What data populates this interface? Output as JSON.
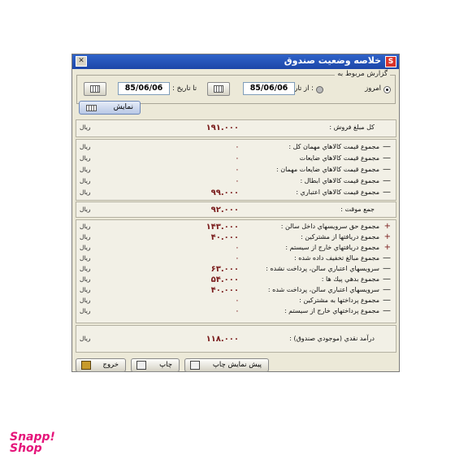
{
  "window": {
    "title": "خلاصه وضعيت صندوق",
    "app_icon": "app-logo-icon",
    "close_icon": "close-icon"
  },
  "report_group": {
    "label": "گزارش مربوط به",
    "today_label": "امروز",
    "from_label": ": از تاريخ",
    "to_label": "تا تاريخ :",
    "from_date": "85/06/06",
    "to_date": "85/06/06",
    "today_selected": true
  },
  "show_button": {
    "label": "نمايش"
  },
  "total_sales": {
    "label": "كل مبلغ فروش :",
    "value": "۱۹۱.۰۰۰",
    "unit": "ريال"
  },
  "deductions": [
    {
      "sign": "—",
      "label": "مجموع قيمت كالاهاي مهمان كل :",
      "value": "۰",
      "unit": "ريال"
    },
    {
      "sign": "—",
      "label": "مجموع قيمت كالاهاي ضايعات",
      "value": "۰",
      "unit": "ريال"
    },
    {
      "sign": "—",
      "label": "مجموع قيمت كالاهاي ضايعات مهمان :",
      "value": "۰",
      "unit": "ريال"
    },
    {
      "sign": "—",
      "label": "مجموع قيمت كالاهاي ابطال :",
      "value": "۰",
      "unit": "ريال"
    },
    {
      "sign": "—",
      "label": "مجموع قيمت كالاهاي اعتباري :",
      "value": "۹۹.۰۰۰",
      "unit": "ريال"
    }
  ],
  "subtotal": {
    "label": "جمع موقت :",
    "value": "۹۲.۰۰۰",
    "unit": "ريال"
  },
  "adjustments": [
    {
      "sign": "+",
      "label": "مجموع حق سرويسهاي داخل سالن :",
      "value": "۱۴۳.۰۰۰",
      "unit": "ريال"
    },
    {
      "sign": "+",
      "label": "مجموع دريافتها از مشتركين :",
      "value": "۴۰.۰۰۰",
      "unit": "ريال"
    },
    {
      "sign": "+",
      "label": "مجموع دريافتهاي خارج از سيستم :",
      "value": "۰",
      "unit": "ريال"
    },
    {
      "sign": "—",
      "label": "مجموع مبالغ تخفيف داده شده :",
      "value": "۰",
      "unit": "ريال"
    },
    {
      "sign": "—",
      "label": "سرويسهاي اعتباري سالن، پرداخت نشده :",
      "value": "۶۳.۰۰۰",
      "unit": "ريال"
    },
    {
      "sign": "—",
      "label": "مجموع بدهي پيك ها :",
      "value": "۵۴.۰۰۰",
      "unit": "ريال"
    },
    {
      "sign": "—",
      "label": "سرويسهاي اعتباري سالن، پرداخت شده :",
      "value": "۴۰.۰۰۰",
      "unit": "ريال"
    },
    {
      "sign": "—",
      "label": "مجموع پرداختها به مشتركين :",
      "value": "۰",
      "unit": "ريال"
    },
    {
      "sign": "—",
      "label": "مجموع پرداختهاي خارج از سيستم :",
      "value": "۰",
      "unit": "ريال"
    }
  ],
  "cash_income": {
    "label": "درآمد نقدي (موجودي صندوق) :",
    "value": "۱۱۸.۰۰۰",
    "unit": "ريال"
  },
  "buttons": {
    "preview_print": "پيش نمايش چاپ",
    "print": "چاپ",
    "exit": "خروج"
  },
  "watermark": {
    "line1": "Snapp!",
    "line2": "Shop"
  }
}
